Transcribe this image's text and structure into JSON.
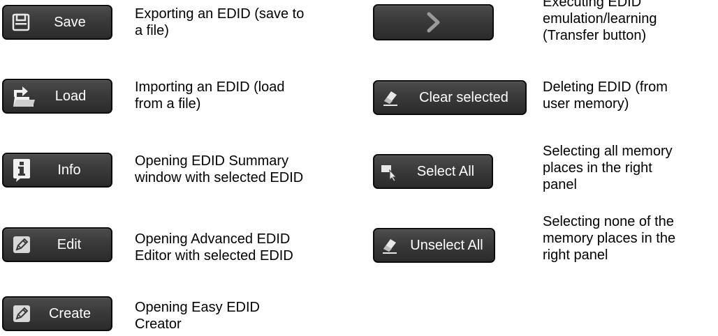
{
  "colors": {
    "button_bg": "#3a3a3a",
    "button_border": "#0b0b0b",
    "button_text": "#ffffff",
    "text": "#000000"
  },
  "left_column": [
    {
      "label": "Save",
      "icon": "floppy-disk-icon",
      "description": "Exporting an EDID (save to\na file)"
    },
    {
      "label": "Load",
      "icon": "load-arrow-icon",
      "description": "Importing an EDID (load\nfrom a file)"
    },
    {
      "label": "Info",
      "icon": "info-icon",
      "description": "Opening EDID Summary\nwindow with selected EDID"
    },
    {
      "label": "Edit",
      "icon": "pencil-icon",
      "description": "Opening Advanced EDID\nEditor with selected EDID"
    },
    {
      "label": "Create",
      "icon": "pencil-icon",
      "description": "Opening Easy EDID\nCreator"
    }
  ],
  "right_column": [
    {
      "label": "",
      "icon": "chevron-right-icon",
      "description": "Executing EDID\nemulation/learning\n(Transfer button)"
    },
    {
      "label": "Clear selected",
      "icon": "eraser-icon",
      "description": "Deleting EDID (from\nuser memory)"
    },
    {
      "label": "Select All",
      "icon": "cursor-select-icon",
      "description": "Selecting all memory\nplaces in the right\npanel"
    },
    {
      "label": "Unselect All",
      "icon": "eraser-icon",
      "description": "Selecting none of the\nmemory places in the\nright panel"
    }
  ]
}
